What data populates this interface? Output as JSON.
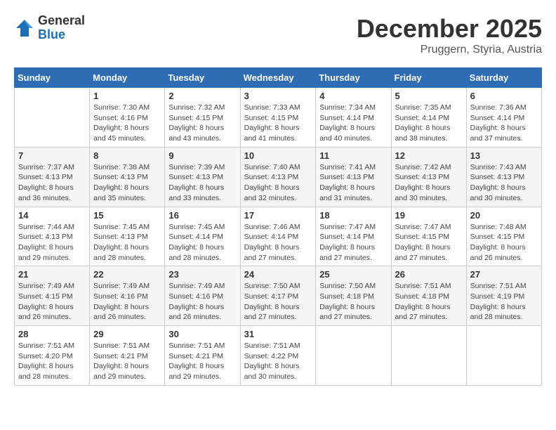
{
  "logo": {
    "general": "General",
    "blue": "Blue"
  },
  "title": "December 2025",
  "subtitle": "Pruggern, Styria, Austria",
  "days_of_week": [
    "Sunday",
    "Monday",
    "Tuesday",
    "Wednesday",
    "Thursday",
    "Friday",
    "Saturday"
  ],
  "weeks": [
    [
      {
        "day": "",
        "detail": ""
      },
      {
        "day": "1",
        "detail": "Sunrise: 7:30 AM\nSunset: 4:16 PM\nDaylight: 8 hours\nand 45 minutes."
      },
      {
        "day": "2",
        "detail": "Sunrise: 7:32 AM\nSunset: 4:15 PM\nDaylight: 8 hours\nand 43 minutes."
      },
      {
        "day": "3",
        "detail": "Sunrise: 7:33 AM\nSunset: 4:15 PM\nDaylight: 8 hours\nand 41 minutes."
      },
      {
        "day": "4",
        "detail": "Sunrise: 7:34 AM\nSunset: 4:14 PM\nDaylight: 8 hours\nand 40 minutes."
      },
      {
        "day": "5",
        "detail": "Sunrise: 7:35 AM\nSunset: 4:14 PM\nDaylight: 8 hours\nand 38 minutes."
      },
      {
        "day": "6",
        "detail": "Sunrise: 7:36 AM\nSunset: 4:14 PM\nDaylight: 8 hours\nand 37 minutes."
      }
    ],
    [
      {
        "day": "7",
        "detail": "Sunrise: 7:37 AM\nSunset: 4:13 PM\nDaylight: 8 hours\nand 36 minutes."
      },
      {
        "day": "8",
        "detail": "Sunrise: 7:38 AM\nSunset: 4:13 PM\nDaylight: 8 hours\nand 35 minutes."
      },
      {
        "day": "9",
        "detail": "Sunrise: 7:39 AM\nSunset: 4:13 PM\nDaylight: 8 hours\nand 33 minutes."
      },
      {
        "day": "10",
        "detail": "Sunrise: 7:40 AM\nSunset: 4:13 PM\nDaylight: 8 hours\nand 32 minutes."
      },
      {
        "day": "11",
        "detail": "Sunrise: 7:41 AM\nSunset: 4:13 PM\nDaylight: 8 hours\nand 31 minutes."
      },
      {
        "day": "12",
        "detail": "Sunrise: 7:42 AM\nSunset: 4:13 PM\nDaylight: 8 hours\nand 30 minutes."
      },
      {
        "day": "13",
        "detail": "Sunrise: 7:43 AM\nSunset: 4:13 PM\nDaylight: 8 hours\nand 30 minutes."
      }
    ],
    [
      {
        "day": "14",
        "detail": "Sunrise: 7:44 AM\nSunset: 4:13 PM\nDaylight: 8 hours\nand 29 minutes."
      },
      {
        "day": "15",
        "detail": "Sunrise: 7:45 AM\nSunset: 4:13 PM\nDaylight: 8 hours\nand 28 minutes."
      },
      {
        "day": "16",
        "detail": "Sunrise: 7:45 AM\nSunset: 4:14 PM\nDaylight: 8 hours\nand 28 minutes."
      },
      {
        "day": "17",
        "detail": "Sunrise: 7:46 AM\nSunset: 4:14 PM\nDaylight: 8 hours\nand 27 minutes."
      },
      {
        "day": "18",
        "detail": "Sunrise: 7:47 AM\nSunset: 4:14 PM\nDaylight: 8 hours\nand 27 minutes."
      },
      {
        "day": "19",
        "detail": "Sunrise: 7:47 AM\nSunset: 4:15 PM\nDaylight: 8 hours\nand 27 minutes."
      },
      {
        "day": "20",
        "detail": "Sunrise: 7:48 AM\nSunset: 4:15 PM\nDaylight: 8 hours\nand 26 minutes."
      }
    ],
    [
      {
        "day": "21",
        "detail": "Sunrise: 7:49 AM\nSunset: 4:15 PM\nDaylight: 8 hours\nand 26 minutes."
      },
      {
        "day": "22",
        "detail": "Sunrise: 7:49 AM\nSunset: 4:16 PM\nDaylight: 8 hours\nand 26 minutes."
      },
      {
        "day": "23",
        "detail": "Sunrise: 7:49 AM\nSunset: 4:16 PM\nDaylight: 8 hours\nand 26 minutes."
      },
      {
        "day": "24",
        "detail": "Sunrise: 7:50 AM\nSunset: 4:17 PM\nDaylight: 8 hours\nand 27 minutes."
      },
      {
        "day": "25",
        "detail": "Sunrise: 7:50 AM\nSunset: 4:18 PM\nDaylight: 8 hours\nand 27 minutes."
      },
      {
        "day": "26",
        "detail": "Sunrise: 7:51 AM\nSunset: 4:18 PM\nDaylight: 8 hours\nand 27 minutes."
      },
      {
        "day": "27",
        "detail": "Sunrise: 7:51 AM\nSunset: 4:19 PM\nDaylight: 8 hours\nand 28 minutes."
      }
    ],
    [
      {
        "day": "28",
        "detail": "Sunrise: 7:51 AM\nSunset: 4:20 PM\nDaylight: 8 hours\nand 28 minutes."
      },
      {
        "day": "29",
        "detail": "Sunrise: 7:51 AM\nSunset: 4:21 PM\nDaylight: 8 hours\nand 29 minutes."
      },
      {
        "day": "30",
        "detail": "Sunrise: 7:51 AM\nSunset: 4:21 PM\nDaylight: 8 hours\nand 29 minutes."
      },
      {
        "day": "31",
        "detail": "Sunrise: 7:51 AM\nSunset: 4:22 PM\nDaylight: 8 hours\nand 30 minutes."
      },
      {
        "day": "",
        "detail": ""
      },
      {
        "day": "",
        "detail": ""
      },
      {
        "day": "",
        "detail": ""
      }
    ]
  ]
}
